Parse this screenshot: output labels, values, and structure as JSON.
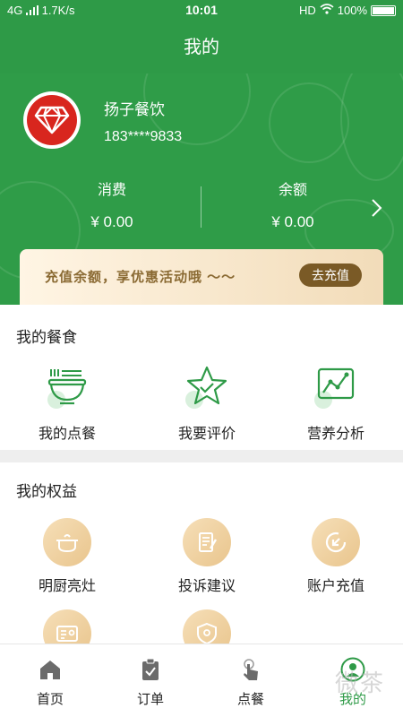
{
  "status_bar": {
    "network": "4G",
    "speed": "1.7K/s",
    "time": "10:01",
    "hd": "HD",
    "battery": "100%"
  },
  "title_bar": {
    "title": "我的"
  },
  "profile": {
    "name": "扬子餐饮",
    "phone": "183****9833"
  },
  "stats": {
    "spent_label": "消费",
    "spent_value": "¥ 0.00",
    "balance_label": "余额",
    "balance_value": "¥ 0.00"
  },
  "promo": {
    "text": "充值余额，享优惠活动哦 ～～",
    "button": "去充值"
  },
  "meals_section": {
    "title": "我的餐食",
    "items": [
      {
        "label": "我的点餐",
        "icon": "bowl-icon"
      },
      {
        "label": "我要评价",
        "icon": "star-icon"
      },
      {
        "label": "营养分析",
        "icon": "chart-icon"
      }
    ]
  },
  "rights_section": {
    "title": "我的权益",
    "items": [
      {
        "label": "明厨亮灶",
        "icon": "cooking-pot-icon"
      },
      {
        "label": "投诉建议",
        "icon": "edit-document-icon"
      },
      {
        "label": "账户充值",
        "icon": "recharge-icon"
      },
      {
        "label": "",
        "icon": "id-card-icon"
      },
      {
        "label": "",
        "icon": "shield-icon"
      }
    ]
  },
  "tabbar": {
    "tabs": [
      {
        "label": "首页",
        "icon": "home-icon"
      },
      {
        "label": "订单",
        "icon": "clipboard-icon"
      },
      {
        "label": "点餐",
        "icon": "tap-icon"
      },
      {
        "label": "我的",
        "icon": "user-icon"
      }
    ],
    "active_index": 3
  },
  "watermark": "微茶",
  "colors": {
    "primary": "#2e9a47",
    "gold": "#7a5a26",
    "avatar_red": "#d8261e"
  }
}
